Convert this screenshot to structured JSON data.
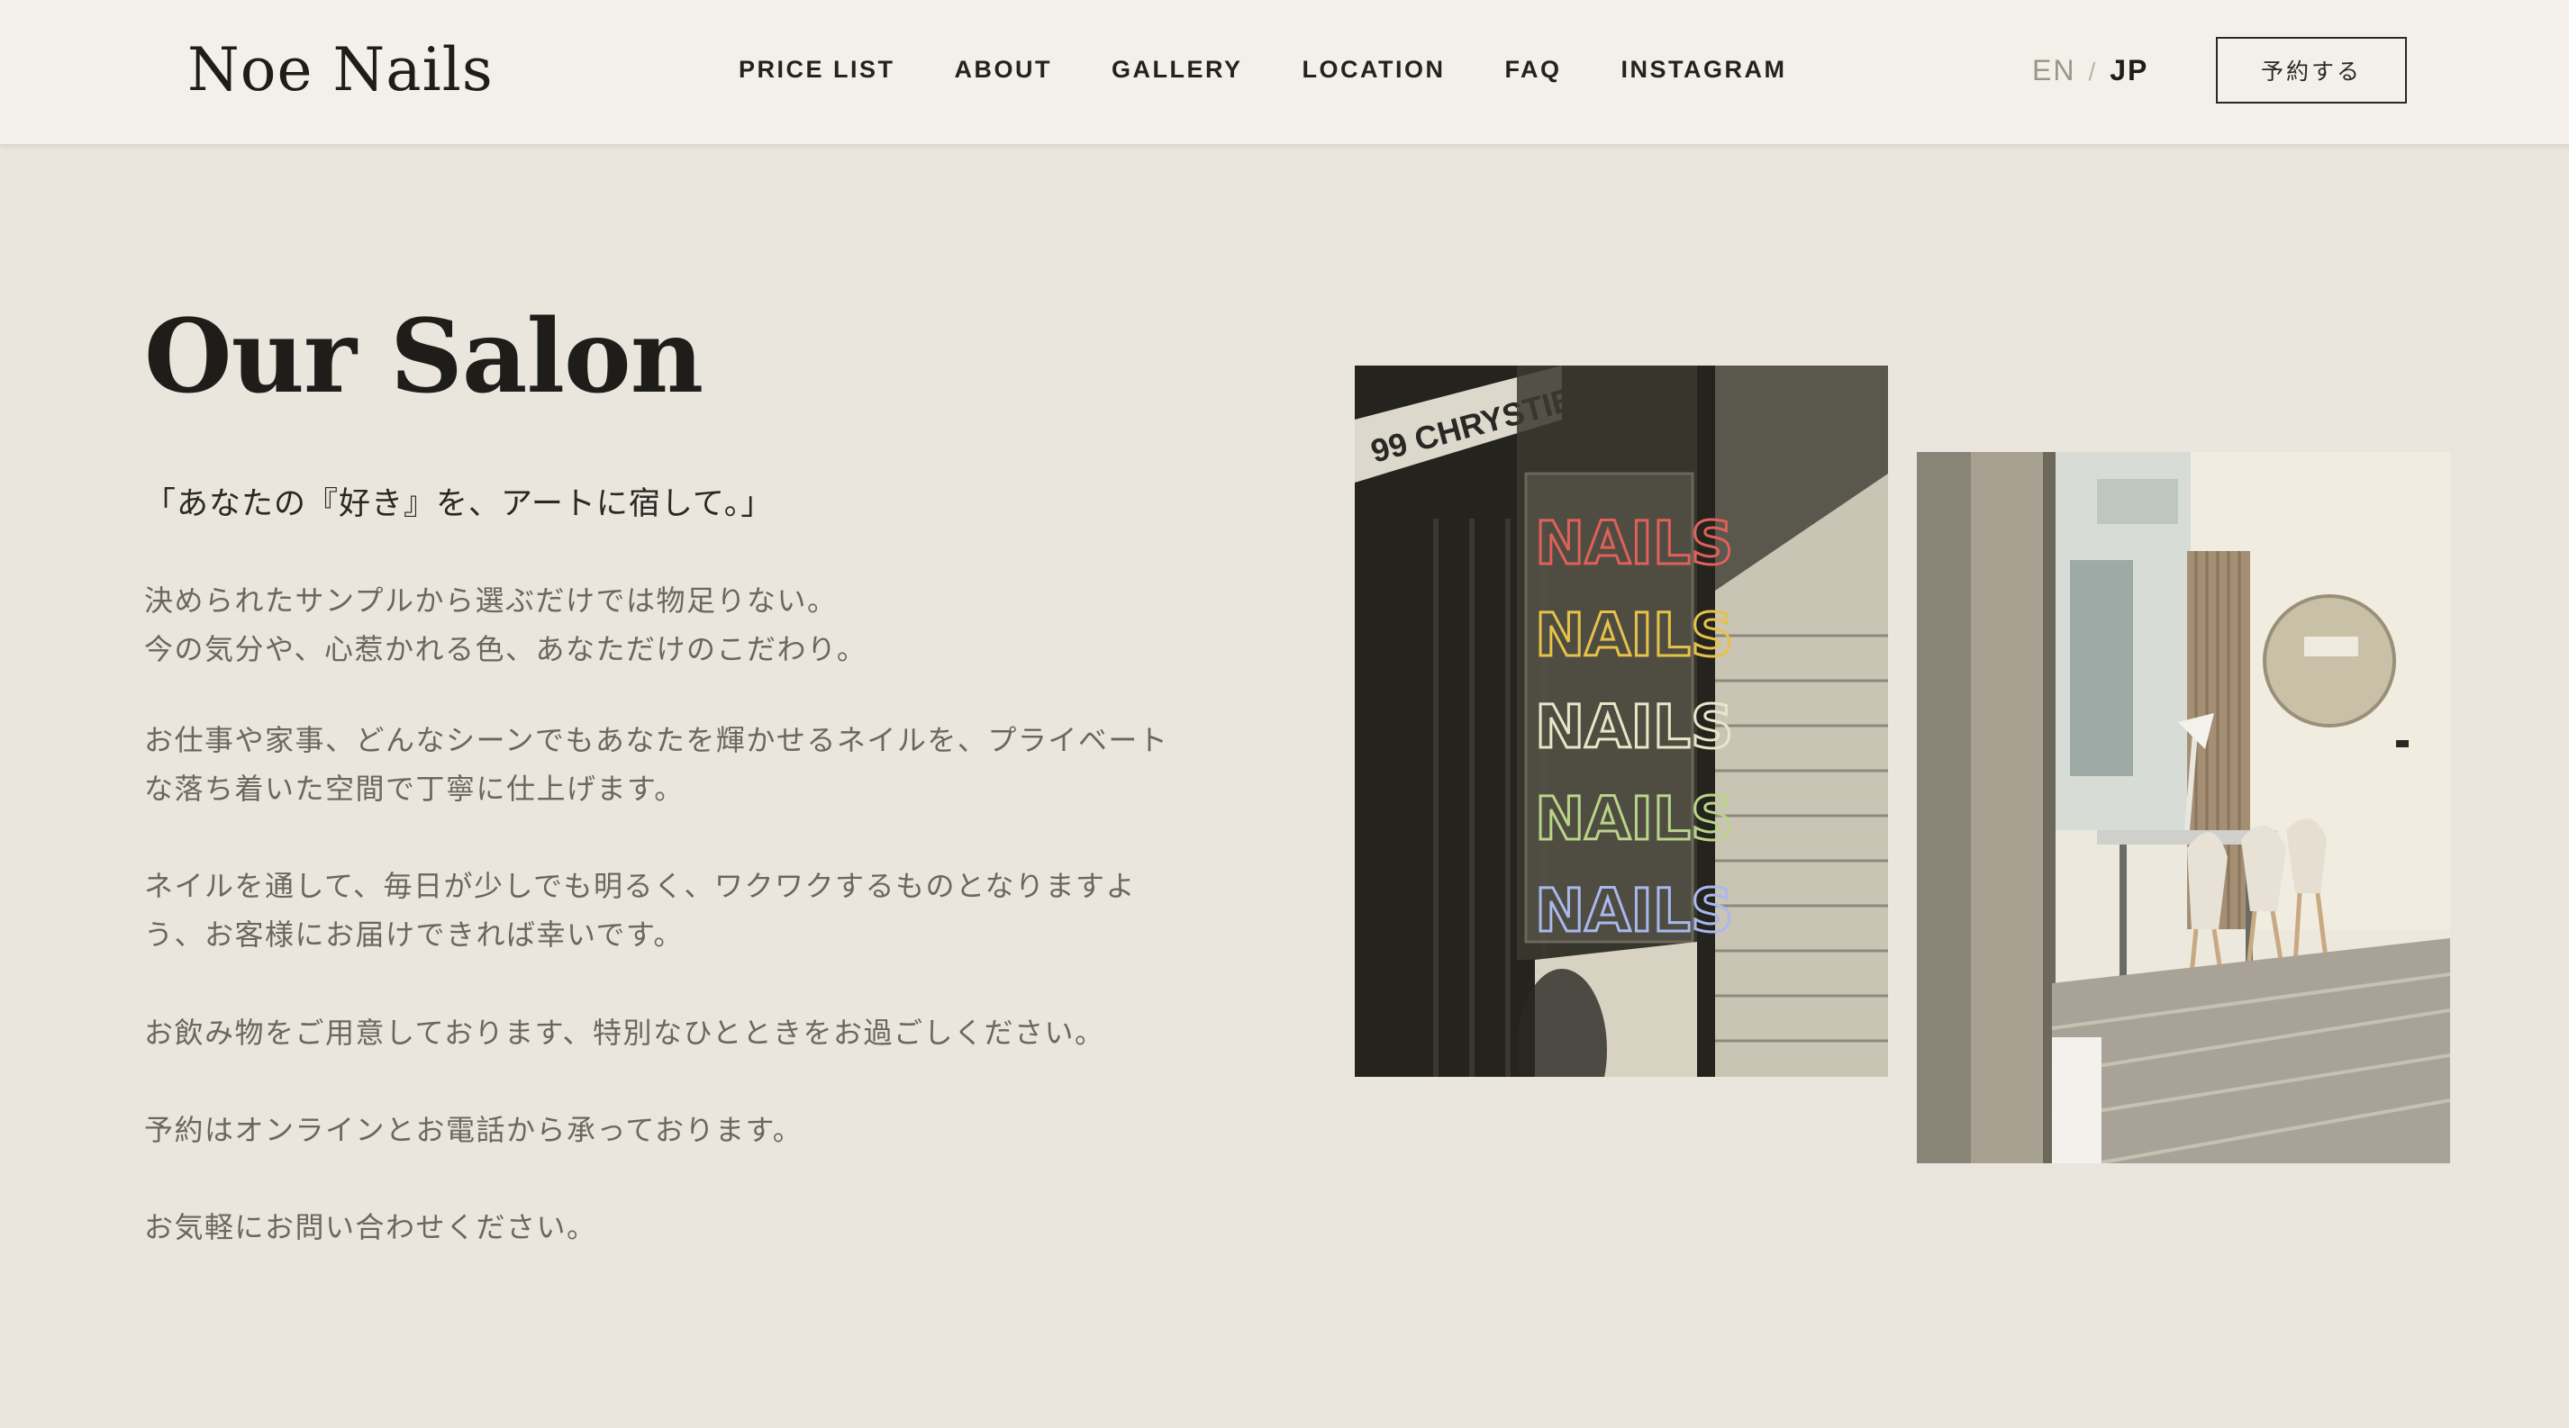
{
  "header": {
    "logo": "Noe Nails",
    "nav": [
      {
        "label": "PRICE LIST"
      },
      {
        "label": "ABOUT"
      },
      {
        "label": "GALLERY"
      },
      {
        "label": "LOCATION"
      },
      {
        "label": "FAQ"
      },
      {
        "label": "INSTAGRAM"
      }
    ],
    "lang": {
      "en": "EN",
      "separator": "/",
      "jp": "JP"
    },
    "reserve_label": "予約する"
  },
  "main": {
    "title": "Our Salon",
    "tagline": "「あなたの『好き』を、アートに宿して。」",
    "paragraphs": [
      {
        "lines": [
          "決められたサンプルから選ぶだけでは物足りない。",
          "今の気分や、心惹かれる色、あなただけのこだわり。"
        ]
      },
      {
        "lines": [
          "お仕事や家事、どんなシーンでもあなたを輝かせるネイルを、プライベート",
          "な落ち着いた空間で丁寧に仕上げます。"
        ]
      },
      {
        "lines": [
          "ネイルを通して、毎日が少しでも明るく、ワクワクするものとなりますよ",
          "う、お客様にお届けできれば幸いです。"
        ]
      },
      {
        "lines": [
          "お飲み物をご用意しております、特別なひとときをお過ごしください。"
        ]
      },
      {
        "lines": [
          "予約はオンラインとお電話から承っております。"
        ]
      },
      {
        "lines": [
          "お気軽にお問い合わせください。"
        ]
      }
    ],
    "photos": {
      "storefront": {
        "sign_text": "99 CHRYSTIE",
        "neon_word": "NAILS",
        "neon_colors": [
          "#e0605a",
          "#e6c24a",
          "#e8e6c8",
          "#b9d48a",
          "#a9b8ee"
        ]
      },
      "interior": {}
    }
  },
  "colors": {
    "page_bg": "#eae6dd",
    "header_bg": "#f3f0e9",
    "text_dark": "#1f1d1a",
    "text_muted": "#6b6760"
  }
}
